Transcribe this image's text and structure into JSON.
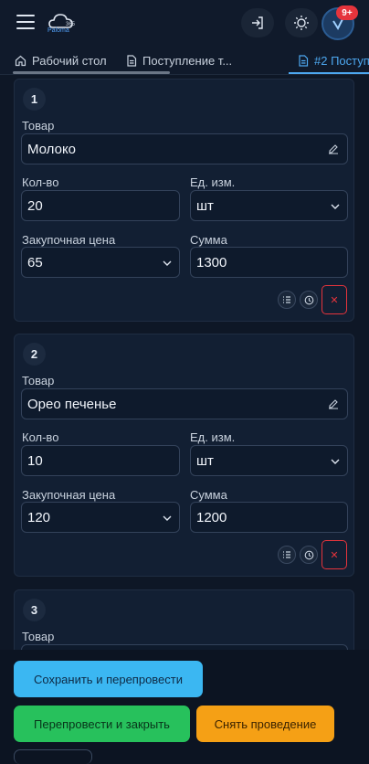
{
  "header": {
    "logo_text": "Paloma",
    "logo_num": "365",
    "notif_badge": "9+"
  },
  "tabs": [
    {
      "label": "Рабочий стол",
      "icon": "home-icon"
    },
    {
      "label": "Поступление т...",
      "icon": "document-icon"
    },
    {
      "label": "#2 Поступ",
      "icon": "document-icon"
    }
  ],
  "cards": [
    {
      "num": "1",
      "product_label": "Товар",
      "product": "Молоко",
      "qty_label": "Кол-во",
      "qty": "20",
      "unit_label": "Ед. изм.",
      "unit": "шт",
      "price_label": "Закупочная цена",
      "price": "65",
      "sum_label": "Сумма",
      "sum": "1300"
    },
    {
      "num": "2",
      "product_label": "Товар",
      "product": "Орео печенье",
      "qty_label": "Кол-во",
      "qty": "10",
      "unit_label": "Ед. изм.",
      "unit": "шт",
      "price_label": "Закупочная цена",
      "price": "120",
      "sum_label": "Сумма",
      "sum": "1200"
    },
    {
      "num": "3",
      "product_label": "Товар"
    }
  ],
  "footer": {
    "save_label": "Сохранить и перепровести",
    "repost_close_label": "Перепровести и закрыть",
    "unpost_label": "Снять проведение"
  },
  "colors": {
    "accent": "#4da8f0",
    "danger": "#e5343c",
    "cyan": "#3bb7f2",
    "green": "#27c15c",
    "orange": "#f5a015"
  }
}
